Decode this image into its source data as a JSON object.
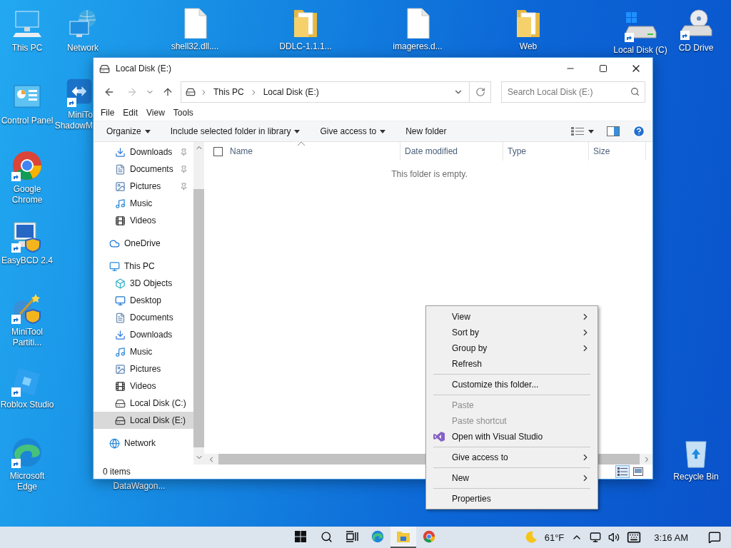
{
  "desktop_icons": [
    {
      "label": "This PC",
      "kind": "pc",
      "shortcut": false
    },
    {
      "label": "Network",
      "kind": "network",
      "shortcut": false
    },
    {
      "label": "shell32.dll....",
      "kind": "file",
      "shortcut": false
    },
    {
      "label": "DDLC-1.1.1...",
      "kind": "folder",
      "shortcut": false
    },
    {
      "label": "imageres.d...",
      "kind": "file",
      "shortcut": false
    },
    {
      "label": "Web",
      "kind": "folder",
      "shortcut": false
    },
    {
      "label": "Local Disk (C)",
      "kind": "drive",
      "shortcut": true
    },
    {
      "label": "CD Drive",
      "kind": "cd",
      "shortcut": true
    },
    {
      "label": "Control Panel",
      "kind": "control-panel",
      "shortcut": false
    },
    {
      "label": "MiniTo ShadowM",
      "kind": "arrows-app",
      "shortcut": true
    },
    {
      "label": "Google Chrome",
      "kind": "chrome",
      "shortcut": true
    },
    {
      "label": "EasyBCD 2.4",
      "kind": "monitor-shield",
      "shortcut": true
    },
    {
      "label": "MiniTool Partiti...",
      "kind": "wand-shield",
      "shortcut": true
    },
    {
      "label": "Roblox Studio",
      "kind": "tilted-square",
      "shortcut": true
    },
    {
      "label": "Microsoft Edge",
      "kind": "edge",
      "shortcut": true
    },
    {
      "label": "DataWagon...",
      "shortcut": false
    },
    {
      "label": "Recycle Bin",
      "kind": "recycle",
      "shortcut": false
    }
  ],
  "explorer": {
    "title": "Local Disk (E:)",
    "path": [
      "This PC",
      "Local Disk (E:)"
    ],
    "search": {
      "placeholder": "Search Local Disk (E:)"
    },
    "menu": [
      "File",
      "Edit",
      "View",
      "Tools"
    ],
    "commands": [
      {
        "label": "Organize",
        "dropdown": true
      },
      {
        "label": "Include selected folder in library",
        "dropdown": true
      },
      {
        "label": "Give access to",
        "dropdown": true
      },
      {
        "label": "New folder",
        "dropdown": false
      }
    ],
    "quick_access": [
      {
        "label": "Downloads",
        "kind": "downloads",
        "pinned": true,
        "selected": false
      },
      {
        "label": "Documents",
        "kind": "documents",
        "pinned": true,
        "selected": false
      },
      {
        "label": "Pictures",
        "kind": "pictures",
        "pinned": true,
        "selected": false
      },
      {
        "label": "Music",
        "kind": "music",
        "pinned": false,
        "selected": false
      },
      {
        "label": "Videos",
        "kind": "videos",
        "pinned": false,
        "selected": false
      }
    ],
    "tree": [
      {
        "label": "OneDrive",
        "kind": "cloud",
        "selected": false
      },
      {
        "label": "This PC",
        "kind": "pc",
        "selected": false,
        "children": [
          {
            "label": "3D Objects",
            "kind": "objects",
            "selected": false
          },
          {
            "label": "Desktop",
            "kind": "desktop",
            "selected": false
          },
          {
            "label": "Documents",
            "kind": "documents",
            "selected": false
          },
          {
            "label": "Downloads",
            "kind": "downloads",
            "selected": false
          },
          {
            "label": "Music",
            "kind": "music",
            "selected": false
          },
          {
            "label": "Pictures",
            "kind": "pictures",
            "selected": false
          },
          {
            "label": "Videos",
            "kind": "videos",
            "selected": false
          },
          {
            "label": "Local Disk (C:)",
            "kind": "drive-windows",
            "selected": false
          },
          {
            "label": "Local Disk (E:)",
            "kind": "drive",
            "selected": true
          }
        ]
      },
      {
        "label": "Network",
        "kind": "network",
        "selected": false
      }
    ],
    "select_all": {
      "checked": false
    },
    "columns": [
      {
        "label": "Name",
        "sorted": true
      },
      {
        "label": "Date modified",
        "sorted": false
      },
      {
        "label": "Type",
        "sorted": false
      },
      {
        "label": "Size",
        "sorted": false
      }
    ],
    "empty_text": "This folder is empty.",
    "status": "0 items",
    "views": [
      {
        "kind": "details",
        "selected": true
      },
      {
        "kind": "large-icons",
        "selected": false
      }
    ]
  },
  "context_menu": [
    {
      "kind": "item",
      "label": "View",
      "submenu": true,
      "disabled": false
    },
    {
      "kind": "item",
      "label": "Sort by",
      "submenu": true,
      "disabled": false
    },
    {
      "kind": "item",
      "label": "Group by",
      "submenu": true,
      "disabled": false
    },
    {
      "kind": "item",
      "label": "Refresh",
      "submenu": false,
      "disabled": false
    },
    {
      "kind": "separator"
    },
    {
      "kind": "item",
      "label": "Customize this folder...",
      "submenu": false,
      "disabled": false
    },
    {
      "kind": "separator"
    },
    {
      "kind": "item",
      "label": "Paste",
      "submenu": false,
      "disabled": true
    },
    {
      "kind": "item",
      "label": "Paste shortcut",
      "submenu": false,
      "disabled": true
    },
    {
      "kind": "app-item",
      "label": "Open with Visual Studio",
      "submenu": false,
      "disabled": false
    },
    {
      "kind": "separator"
    },
    {
      "kind": "item",
      "label": "Give access to",
      "submenu": true,
      "disabled": false
    },
    {
      "kind": "separator"
    },
    {
      "kind": "item",
      "label": "New",
      "submenu": true,
      "disabled": false
    },
    {
      "kind": "separator"
    },
    {
      "kind": "item",
      "label": "Properties",
      "submenu": false,
      "disabled": false
    }
  ],
  "taskbar": {
    "apps": [
      {
        "kind": "start",
        "active": false
      },
      {
        "kind": "search",
        "active": false
      },
      {
        "kind": "task-view",
        "active": false
      },
      {
        "kind": "edge",
        "active": false
      },
      {
        "kind": "explorer",
        "active": true
      },
      {
        "kind": "chrome",
        "active": false
      }
    ],
    "weather": "61°F",
    "time": "3:16 AM"
  }
}
